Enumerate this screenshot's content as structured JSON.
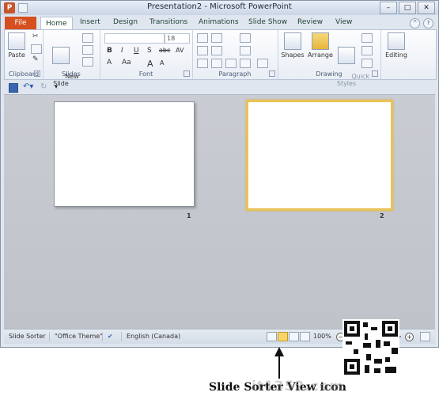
{
  "window": {
    "title": "Presentation2  -  Microsoft PowerPoint",
    "app_icon_letter": "P",
    "minimize": "–",
    "restore": "□",
    "close": "✕"
  },
  "tabs": {
    "file": "File",
    "items": [
      "Home",
      "Insert",
      "Design",
      "Transitions",
      "Animations",
      "Slide Show",
      "Review",
      "View"
    ]
  },
  "ribbon": {
    "groups": [
      "Clipboard",
      "Slides",
      "Font",
      "Paragraph",
      "Drawing"
    ],
    "paste": "Paste",
    "new_slide": "New\nSlide",
    "font_size": "18",
    "shapes": "Shapes",
    "arrange": "Arrange",
    "quick_styles": "Quick\nStyles",
    "editing": "Editing",
    "font_glyphs": [
      "B",
      "I",
      "U",
      "S",
      "abc",
      "AV",
      "A",
      "Aa",
      "A",
      "A"
    ]
  },
  "slides": [
    {
      "number": "1",
      "selected": false
    },
    {
      "number": "2",
      "selected": true
    }
  ],
  "status": {
    "view_name": "Slide Sorter",
    "theme": "\"Office Theme\"",
    "language": "English (Canada)",
    "zoom": "100%"
  },
  "annotation": {
    "caption": "Slide Sorter View icon",
    "watermark": "it1352.com"
  },
  "colors": {
    "file_tab": "#d64f1f",
    "selected_slide_border": "#e9c356",
    "active_view_button": "#f7d56b"
  }
}
